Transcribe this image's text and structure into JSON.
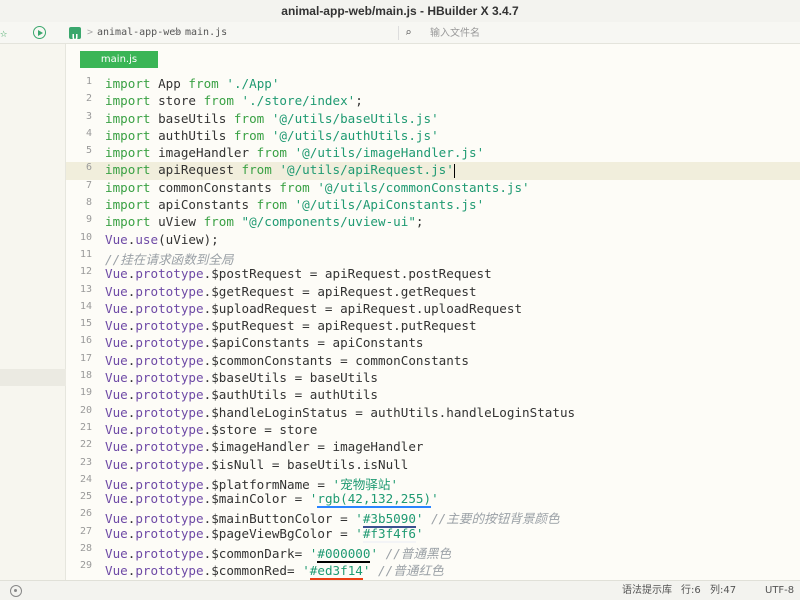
{
  "window": {
    "title": "animal-app-web/main.js - HBuilder X 3.4.7"
  },
  "toolbar": {
    "project_icon_letter": "U",
    "breadcrumb": [
      "animal-app-web",
      "main.js"
    ],
    "separator": ">",
    "file_search_placeholder": "输入文件名"
  },
  "tab": {
    "label": "main.js"
  },
  "editor": {
    "current_line": 6,
    "lines": [
      [
        [
          "kw",
          "import"
        ],
        [
          "id",
          " App "
        ],
        [
          "kw",
          "from"
        ],
        [
          "id",
          " "
        ],
        [
          "str",
          "'./App'"
        ]
      ],
      [
        [
          "kw",
          "import"
        ],
        [
          "id",
          " store "
        ],
        [
          "kw",
          "from"
        ],
        [
          "id",
          " "
        ],
        [
          "str",
          "'./store/index'"
        ],
        [
          "op",
          ";"
        ]
      ],
      [
        [
          "kw",
          "import"
        ],
        [
          "id",
          " baseUtils "
        ],
        [
          "kw",
          "from"
        ],
        [
          "id",
          " "
        ],
        [
          "str",
          "'@/utils/baseUtils.js'"
        ]
      ],
      [
        [
          "kw",
          "import"
        ],
        [
          "id",
          " authUtils "
        ],
        [
          "kw",
          "from"
        ],
        [
          "id",
          " "
        ],
        [
          "str",
          "'@/utils/authUtils.js'"
        ]
      ],
      [
        [
          "kw",
          "import"
        ],
        [
          "id",
          " imageHandler "
        ],
        [
          "kw",
          "from"
        ],
        [
          "id",
          " "
        ],
        [
          "str",
          "'@/utils/imageHandler.js'"
        ]
      ],
      [
        [
          "kw",
          "import"
        ],
        [
          "id",
          " apiRequest "
        ],
        [
          "kw",
          "from"
        ],
        [
          "id",
          " "
        ],
        [
          "str",
          "'@/utils/apiRequest.js'"
        ]
      ],
      [
        [
          "kw",
          "import"
        ],
        [
          "id",
          " commonConstants "
        ],
        [
          "kw",
          "from"
        ],
        [
          "id",
          " "
        ],
        [
          "str",
          "'@/utils/commonConstants.js'"
        ]
      ],
      [
        [
          "kw",
          "import"
        ],
        [
          "id",
          " apiConstants "
        ],
        [
          "kw",
          "from"
        ],
        [
          "id",
          " "
        ],
        [
          "str",
          "'@/utils/ApiConstants.js'"
        ]
      ],
      [
        [
          "kw",
          "import"
        ],
        [
          "id",
          " uView "
        ],
        [
          "kw",
          "from"
        ],
        [
          "id",
          " "
        ],
        [
          "str",
          "\"@/components/uview-ui\""
        ],
        [
          "op",
          ";"
        ]
      ],
      [
        [
          "vue",
          "Vue"
        ],
        [
          "op",
          "."
        ],
        [
          "vue",
          "use"
        ],
        [
          "op",
          "(uView);"
        ]
      ],
      [
        [
          "cmt",
          "//挂在请求函数到全局"
        ]
      ],
      [
        [
          "vue",
          "Vue"
        ],
        [
          "op",
          "."
        ],
        [
          "vue",
          "prototype"
        ],
        [
          "op",
          "."
        ],
        [
          "id",
          "$postRequest = apiRequest.postRequest"
        ]
      ],
      [
        [
          "vue",
          "Vue"
        ],
        [
          "op",
          "."
        ],
        [
          "vue",
          "prototype"
        ],
        [
          "op",
          "."
        ],
        [
          "id",
          "$getRequest = apiRequest.getRequest"
        ]
      ],
      [
        [
          "vue",
          "Vue"
        ],
        [
          "op",
          "."
        ],
        [
          "vue",
          "prototype"
        ],
        [
          "op",
          "."
        ],
        [
          "id",
          "$uploadRequest = apiRequest.uploadRequest"
        ]
      ],
      [
        [
          "vue",
          "Vue"
        ],
        [
          "op",
          "."
        ],
        [
          "vue",
          "prototype"
        ],
        [
          "op",
          "."
        ],
        [
          "id",
          "$putRequest = apiRequest.putRequest"
        ]
      ],
      [
        [
          "vue",
          "Vue"
        ],
        [
          "op",
          "."
        ],
        [
          "vue",
          "prototype"
        ],
        [
          "op",
          "."
        ],
        [
          "id",
          "$apiConstants = apiConstants"
        ]
      ],
      [
        [
          "vue",
          "Vue"
        ],
        [
          "op",
          "."
        ],
        [
          "vue",
          "prototype"
        ],
        [
          "op",
          "."
        ],
        [
          "id",
          "$commonConstants = commonConstants"
        ]
      ],
      [
        [
          "vue",
          "Vue"
        ],
        [
          "op",
          "."
        ],
        [
          "vue",
          "prototype"
        ],
        [
          "op",
          "."
        ],
        [
          "id",
          "$baseUtils = baseUtils"
        ]
      ],
      [
        [
          "vue",
          "Vue"
        ],
        [
          "op",
          "."
        ],
        [
          "vue",
          "prototype"
        ],
        [
          "op",
          "."
        ],
        [
          "id",
          "$authUtils = authUtils"
        ]
      ],
      [
        [
          "vue",
          "Vue"
        ],
        [
          "op",
          "."
        ],
        [
          "vue",
          "prototype"
        ],
        [
          "op",
          "."
        ],
        [
          "id",
          "$handleLoginStatus = authUtils.handleLoginStatus"
        ]
      ],
      [
        [
          "vue",
          "Vue"
        ],
        [
          "op",
          "."
        ],
        [
          "vue",
          "prototype"
        ],
        [
          "op",
          "."
        ],
        [
          "id",
          "$store = store"
        ]
      ],
      [
        [
          "vue",
          "Vue"
        ],
        [
          "op",
          "."
        ],
        [
          "vue",
          "prototype"
        ],
        [
          "op",
          "."
        ],
        [
          "id",
          "$imageHandler = imageHandler"
        ]
      ],
      [
        [
          "vue",
          "Vue"
        ],
        [
          "op",
          "."
        ],
        [
          "vue",
          "prototype"
        ],
        [
          "op",
          "."
        ],
        [
          "id",
          "$isNull = baseUtils.isNull"
        ]
      ],
      [
        [
          "vue",
          "Vue"
        ],
        [
          "op",
          "."
        ],
        [
          "vue",
          "prototype"
        ],
        [
          "op",
          "."
        ],
        [
          "id",
          "$platformName = "
        ],
        [
          "str",
          "'宠物驿站'"
        ]
      ],
      [
        [
          "vue",
          "Vue"
        ],
        [
          "op",
          "."
        ],
        [
          "vue",
          "prototype"
        ],
        [
          "op",
          "."
        ],
        [
          "id",
          "$mainColor = "
        ],
        [
          "str",
          "'"
        ],
        [
          "c1",
          "rgb(42,132,255)"
        ],
        [
          "str",
          "'"
        ]
      ],
      [
        [
          "vue",
          "Vue"
        ],
        [
          "op",
          "."
        ],
        [
          "vue",
          "prototype"
        ],
        [
          "op",
          "."
        ],
        [
          "id",
          "$mainButtonColor = "
        ],
        [
          "str",
          "'"
        ],
        [
          "c2",
          "#3b5090"
        ],
        [
          "str",
          "'"
        ],
        [
          "cmt",
          " //主要的按钮背景颜色"
        ]
      ],
      [
        [
          "vue",
          "Vue"
        ],
        [
          "op",
          "."
        ],
        [
          "vue",
          "prototype"
        ],
        [
          "op",
          "."
        ],
        [
          "id",
          "$pageViewBgColor = "
        ],
        [
          "str",
          "'"
        ],
        [
          "c3",
          "#f3f4f6"
        ],
        [
          "str",
          "'"
        ]
      ],
      [
        [
          "vue",
          "Vue"
        ],
        [
          "op",
          "."
        ],
        [
          "vue",
          "prototype"
        ],
        [
          "op",
          "."
        ],
        [
          "id",
          "$commonDark= "
        ],
        [
          "str",
          "'"
        ],
        [
          "c4",
          "#000000"
        ],
        [
          "str",
          "'"
        ],
        [
          "cmt",
          " //普通黑色"
        ]
      ],
      [
        [
          "vue",
          "Vue"
        ],
        [
          "op",
          "."
        ],
        [
          "vue",
          "prototype"
        ],
        [
          "op",
          "."
        ],
        [
          "id",
          "$commonRed= "
        ],
        [
          "str",
          "'"
        ],
        [
          "c5",
          "#ed3f14"
        ],
        [
          "str",
          "'"
        ],
        [
          "cmt",
          " //普通红色"
        ]
      ]
    ],
    "color_swatches": {
      "c1": "#2a84ff",
      "c2": "#3b5090",
      "c3": "#f3f4f6",
      "c4": "#000000",
      "c5": "#ed3f14"
    }
  },
  "statusbar": {
    "hint_library": "语法提示库",
    "line": "行:6",
    "column": "列:47",
    "encoding": "UTF-8"
  },
  "colors": {
    "accent": "#3ab556",
    "keyword": "#3aa144",
    "string": "#1f9a72",
    "comment": "#9aa0a6"
  }
}
